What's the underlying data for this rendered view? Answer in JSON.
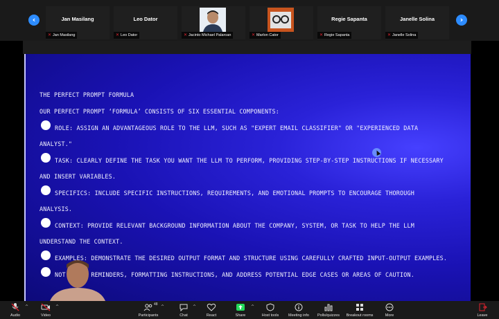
{
  "participants": [
    {
      "display_name": "Jan Masilang",
      "label": "Jan Masilang",
      "mic": "muted"
    },
    {
      "display_name": "Leo Dator",
      "label": "Leo Dator",
      "mic": "muted"
    },
    {
      "display_name": "",
      "label": "Jacinto Michael Palaroan",
      "mic": "muted",
      "has_photo": true
    },
    {
      "display_name": "",
      "label": "Marlon Cator",
      "mic": "muted",
      "has_photo": true
    },
    {
      "display_name": "Regie Sapanta",
      "label": "Regie Sapanta",
      "mic": "muted"
    },
    {
      "display_name": "Janelle Solina",
      "label": "Janelle Solina",
      "mic": "muted"
    }
  ],
  "slide": {
    "title": "THE PERFECT PROMPT FORMULA",
    "intro": "OUR PERFECT PROMPT ‘FORMULA’ CONSISTS OF SIX ESSENTIAL COMPONENTS:",
    "items": [
      {
        "line1": "ROLE: ASSIGN AN ADVANTAGEOUS ROLE TO THE LLM, SUCH AS \"EXPERT EMAIL CLASSIFIER\" OR \"EXPERIENCED DATA",
        "line2": "ANALYST.\""
      },
      {
        "line1": "TASK: CLEARLY DEFINE THE TASK YOU WANT THE LLM TO PERFORM, PROVIDING STEP-BY-STEP INSTRUCTIONS IF NECESSARY",
        "line2": "AND INSERT VARIABLES."
      },
      {
        "line1": "SPECIFICS: INCLUDE SPECIFIC INSTRUCTIONS, REQUIREMENTS, AND EMOTIONAL PROMPTS TO ENCOURAGE THOROUGH",
        "line2": "ANALYSIS."
      },
      {
        "line1": "CONTEXT: PROVIDE RELEVANT BACKGROUND INFORMATION ABOUT THE COMPANY, SYSTEM, OR TASK TO HELP THE LLM",
        "line2": "UNDERSTAND THE CONTEXT."
      },
      {
        "line1": "EXAMPLES: DEMONSTRATE THE DESIRED OUTPUT FORMAT AND STRUCTURE USING CAREFULLY CRAFTED INPUT-OUTPUT EXAMPLES.",
        "line2": ""
      },
      {
        "line1": "NOT   FINAL REMINDERS, FORMATTING INSTRUCTIONS, AND ADDRESS POTENTIAL EDGE CASES OR AREAS OF CAUTION.",
        "line2": ""
      }
    ]
  },
  "toolbar": {
    "audio": "Audio",
    "video": "Video",
    "participants": "Participants",
    "participants_count": "48",
    "chat": "Chat",
    "react": "React",
    "share": "Share",
    "host_tools": "Host tools",
    "meeting_info": "Meeting info",
    "polls": "Polls/quizzes",
    "breakout": "Breakout rooms",
    "more": "More",
    "leave": "Leave"
  },
  "colors": {
    "accent": "#2d8cff",
    "slide_bg": "#2a22d8",
    "muted_red": "#e0232e",
    "share_green": "#23d959"
  }
}
